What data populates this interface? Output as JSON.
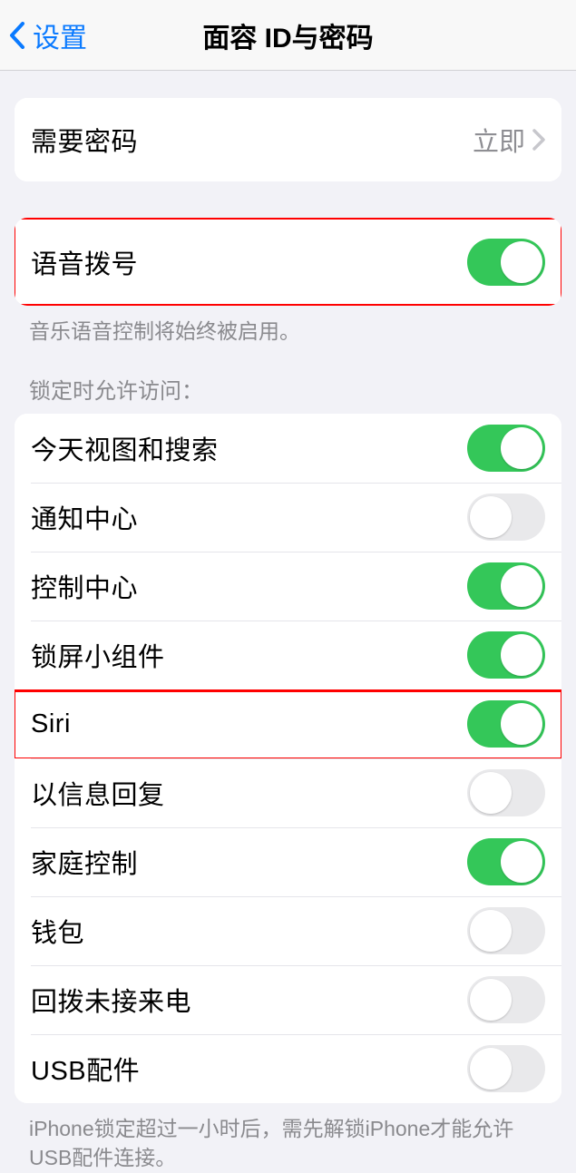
{
  "nav": {
    "back_label": "设置",
    "title": "面容 ID与密码"
  },
  "require_passcode": {
    "label": "需要密码",
    "value": "立即"
  },
  "voice_dial": {
    "label": "语音拨号",
    "footer": "音乐语音控制将始终被启用。"
  },
  "allow_access": {
    "header": "锁定时允许访问：",
    "items": [
      {
        "label": "今天视图和搜索",
        "on": true
      },
      {
        "label": "通知中心",
        "on": false
      },
      {
        "label": "控制中心",
        "on": true
      },
      {
        "label": "锁屏小组件",
        "on": true
      },
      {
        "label": "Siri",
        "on": true
      },
      {
        "label": "以信息回复",
        "on": false
      },
      {
        "label": "家庭控制",
        "on": true
      },
      {
        "label": "钱包",
        "on": false
      },
      {
        "label": "回拨未接来电",
        "on": false
      },
      {
        "label": "USB配件",
        "on": false
      }
    ],
    "footer": "iPhone锁定超过一小时后，需先解锁iPhone才能允许USB配件连接。"
  }
}
